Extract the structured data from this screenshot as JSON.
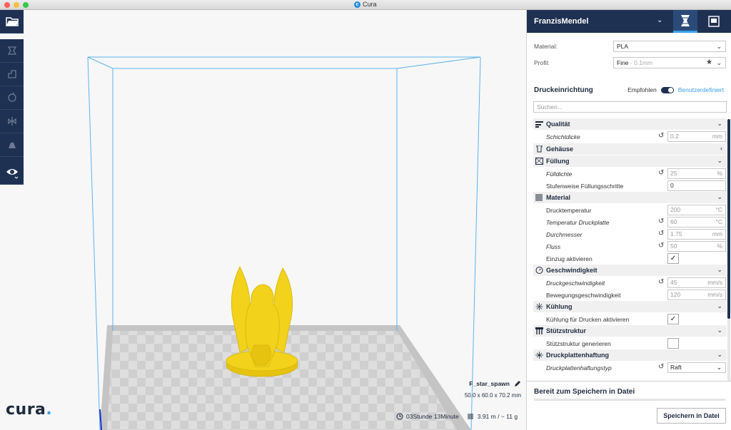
{
  "window": {
    "title": "Cura"
  },
  "machine": {
    "name": "FranzisMendel"
  },
  "material": {
    "label": "Material:",
    "value": "PLA"
  },
  "profile": {
    "label": "Profil:",
    "value": "Fine",
    "sub": " - 0.1mm"
  },
  "print_setup": {
    "title": "Druckeinrichtung",
    "recommended": "Empfohlen",
    "custom": "Benutzerdefiniert"
  },
  "search": {
    "placeholder": "Suchen..."
  },
  "categories": {
    "quality": "Qualität",
    "shell": "Gehäuse",
    "infill": "Füllung",
    "material": "Material",
    "speed": "Geschwindigkeit",
    "cooling": "Kühlung",
    "support": "Stützstruktur",
    "adhesion": "Druckplattenhaftung"
  },
  "settings": {
    "layer_height": {
      "label": "Schichtdicke",
      "value": "0.2",
      "unit": "mm"
    },
    "infill_density": {
      "label": "Fülldichte",
      "value": "25",
      "unit": "%"
    },
    "gradual_infill": {
      "label": "Stufenweise Füllungsschritte",
      "value": "0"
    },
    "print_temp": {
      "label": "Drucktemperatur",
      "value": "200",
      "unit": "°C"
    },
    "bed_temp": {
      "label": "Temperatur Druckplatte",
      "value": "60",
      "unit": "°C"
    },
    "diameter": {
      "label": "Durchmesser",
      "value": "1.75",
      "unit": "mm"
    },
    "flow": {
      "label": "Fluss",
      "value": "50",
      "unit": "%"
    },
    "retraction": {
      "label": "Einzug aktivieren",
      "checked": "✓"
    },
    "print_speed": {
      "label": "Druckgeschwindigkeit",
      "value": "45",
      "unit": "mm/s"
    },
    "travel_speed": {
      "label": "Bewegungsgeschwindigkeit",
      "value": "120",
      "unit": "mm/s"
    },
    "cooling_enable": {
      "label": "Kühlung für Drucken aktivieren",
      "checked": "✓"
    },
    "support_enable": {
      "label": "Stützstruktur generieren",
      "checked": ""
    },
    "adhesion_type": {
      "label": "Druckplattenhaftungstyp",
      "value": "Raft"
    }
  },
  "save": {
    "title": "Bereit zum Speichern in Datei",
    "button": "Speichern in Datei"
  },
  "model": {
    "name": "F_star_spawn",
    "dims": "50.0 x 60.0 x 70.2 mm"
  },
  "print_estimate": {
    "time": "03Stunde 13Minute",
    "material": "3.91 m / ~ 11 g"
  },
  "brand": {
    "logo_text": "cura",
    "logo_dot": "."
  },
  "colors": {
    "navy": "#1f3152",
    "accent": "#3aa0e8",
    "model": "#f2d21a",
    "build_volume": "#5ab4ee"
  }
}
